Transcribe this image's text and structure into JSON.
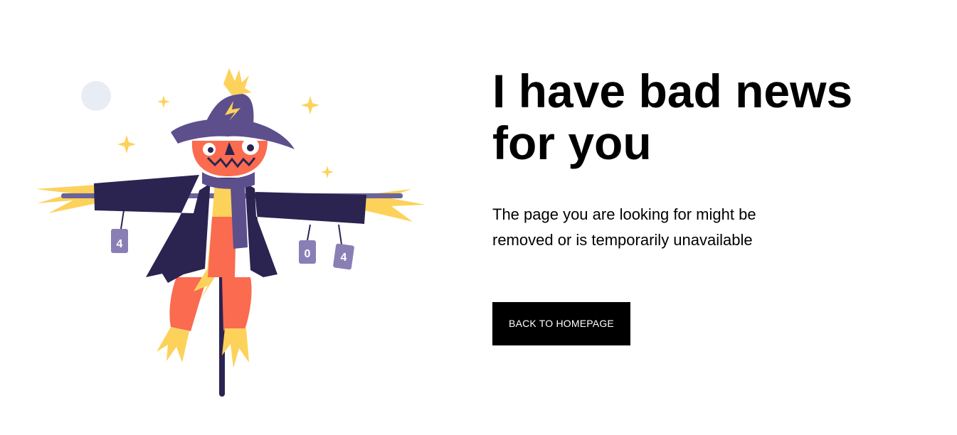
{
  "page": {
    "headline": "I have bad news for you",
    "message": "The page you are looking for might be removed or is temporarily unavailable",
    "button_label": "BACK TO HOMEPAGE"
  },
  "illustration": {
    "subject": "scarecrow",
    "can_labels": [
      "4",
      "0",
      "4"
    ]
  },
  "colors": {
    "button_bg": "#000000",
    "button_text": "#ffffff",
    "hat": "#5c4f8c",
    "coat": "#2b2350",
    "face": "#fa6b50",
    "straw": "#fdd25b",
    "cans": "#8a7fb5",
    "moon": "#e8ecf5"
  }
}
